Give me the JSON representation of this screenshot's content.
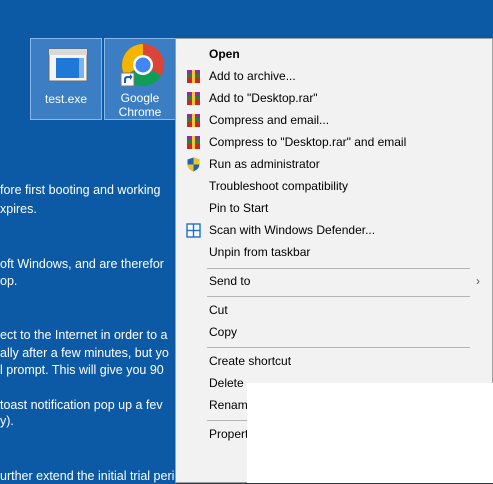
{
  "desktop": {
    "text_lines": [
      "fore first booting and working",
      "xpires.",
      "oft Windows, and are therefor",
      "op.",
      "ect to the Internet in order to a",
      "ally after a few minutes, but yo",
      "l prompt. This will give you 90",
      "toast notification pop up a fev",
      "y).",
      "urther extend the initial trial period if"
    ],
    "icons": [
      {
        "label": "test.exe",
        "icon": "exe-file-icon"
      },
      {
        "label_line1": "Google",
        "label_line2": "Chrome",
        "icon": "chrome-icon"
      }
    ]
  },
  "context_menu": {
    "items": [
      {
        "label": "Open",
        "bold": true
      },
      {
        "label": "Add to archive...",
        "icon": "winrar-icon"
      },
      {
        "label": "Add to \"Desktop.rar\"",
        "icon": "winrar-icon"
      },
      {
        "label": "Compress and email...",
        "icon": "winrar-icon"
      },
      {
        "label": "Compress to \"Desktop.rar\" and email",
        "icon": "winrar-icon"
      },
      {
        "label": "Run as administrator",
        "icon": "uac-shield-icon"
      },
      {
        "label": "Troubleshoot compatibility"
      },
      {
        "label": "Pin to Start"
      },
      {
        "label": "Scan with Windows Defender...",
        "icon": "windows-defender-icon"
      },
      {
        "label": "Unpin from taskbar"
      },
      {
        "label": "Send to",
        "chevron": "›"
      },
      {
        "label": "Cut"
      },
      {
        "label": "Copy"
      },
      {
        "label": "Create shortcut"
      },
      {
        "label": "Delete"
      },
      {
        "label": "Renam"
      },
      {
        "label": "Propert"
      }
    ]
  },
  "colors": {
    "desktop_bg": "#0c5aa6",
    "menu_bg": "#f2f2f2",
    "separator": "#b5b5b5"
  }
}
